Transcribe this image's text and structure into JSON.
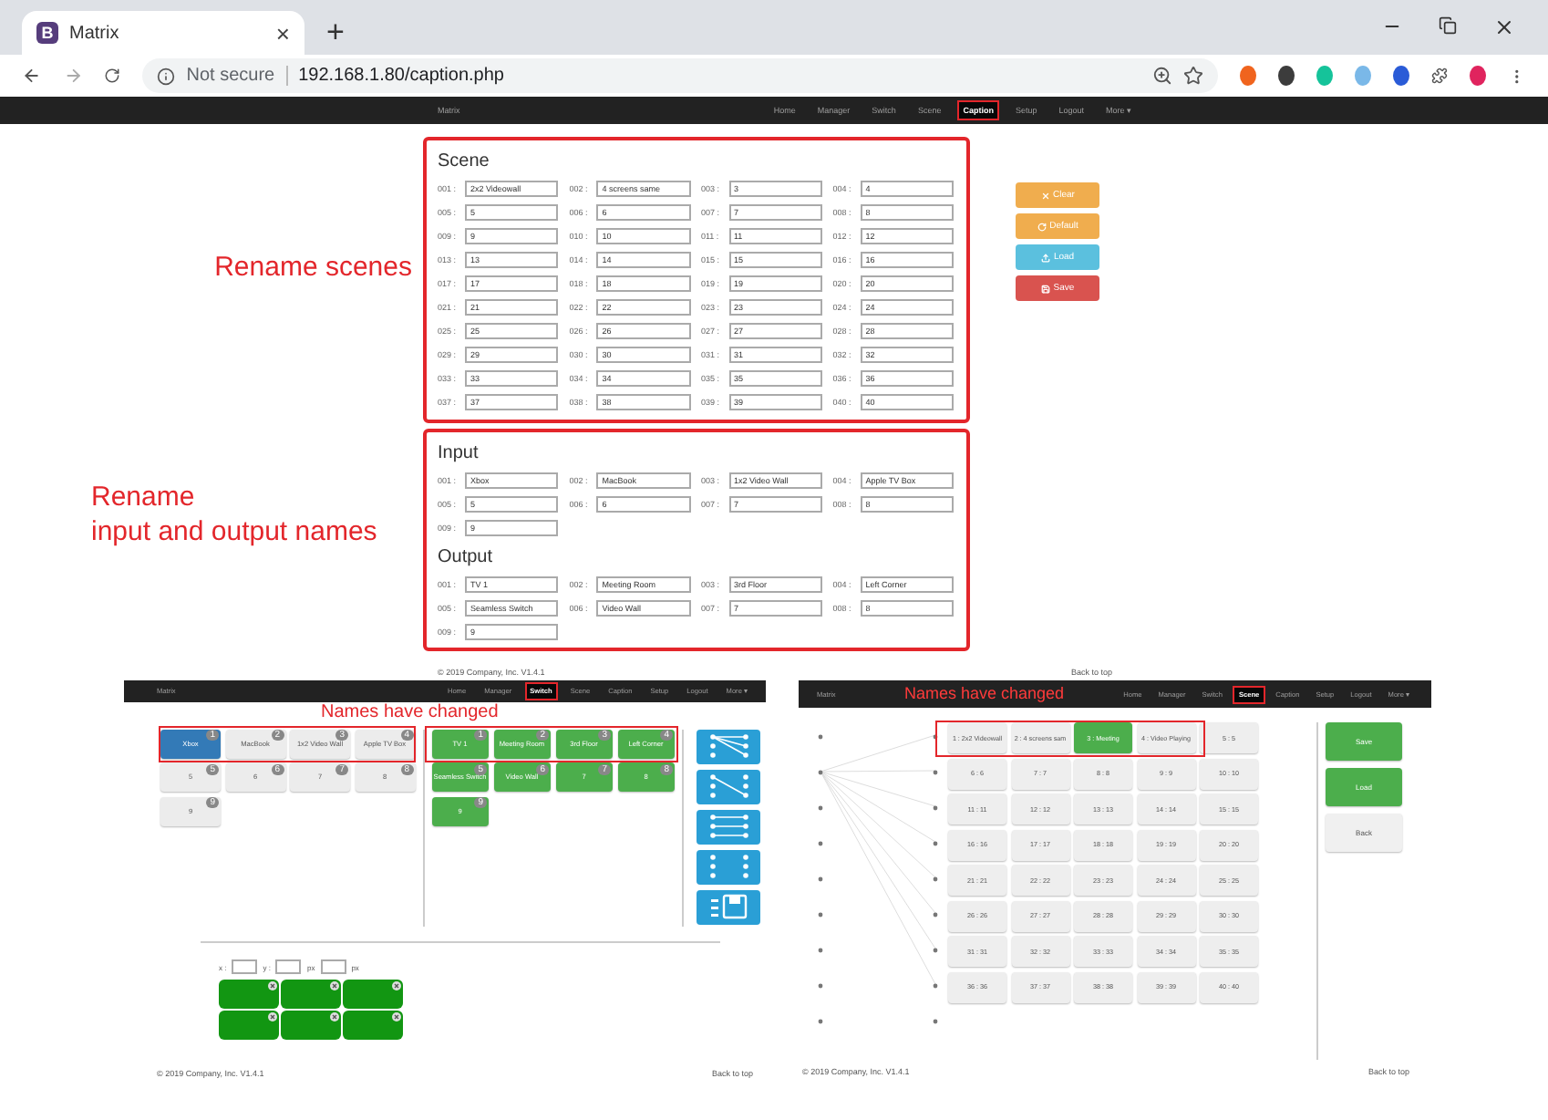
{
  "browser": {
    "favicon": "B",
    "tab_title": "Matrix",
    "tab_close": "×",
    "new_tab": "+",
    "security": "Not secure",
    "url": "192.168.1.80/caption.php"
  },
  "navbar": {
    "brand": "Matrix",
    "items": [
      {
        "label": "Home",
        "selected": false
      },
      {
        "label": "Manager",
        "selected": false
      },
      {
        "label": "Switch",
        "selected": false
      },
      {
        "label": "Scene",
        "selected": false
      },
      {
        "label": "Caption",
        "selected": true
      },
      {
        "label": "Setup",
        "selected": false
      },
      {
        "label": "Logout",
        "selected": false
      },
      {
        "label": "More ▾",
        "selected": false
      }
    ]
  },
  "annotations": {
    "rename_scenes": "Rename scenes",
    "rename_io": [
      "Rename",
      "input and output names"
    ]
  },
  "scene": {
    "title": "Scene",
    "fields": [
      {
        "label": "001 :",
        "value": "2x2 Videowall"
      },
      {
        "label": "002 :",
        "value": "4 screens same"
      },
      {
        "label": "003 :",
        "value": "3"
      },
      {
        "label": "004 :",
        "value": "4"
      },
      {
        "label": "005 :",
        "value": "5"
      },
      {
        "label": "006 :",
        "value": "6"
      },
      {
        "label": "007 :",
        "value": "7"
      },
      {
        "label": "008 :",
        "value": "8"
      },
      {
        "label": "009 :",
        "value": "9"
      },
      {
        "label": "010 :",
        "value": "10"
      },
      {
        "label": "011 :",
        "value": "11"
      },
      {
        "label": "012 :",
        "value": "12"
      },
      {
        "label": "013 :",
        "value": "13"
      },
      {
        "label": "014 :",
        "value": "14"
      },
      {
        "label": "015 :",
        "value": "15"
      },
      {
        "label": "016 :",
        "value": "16"
      },
      {
        "label": "017 :",
        "value": "17"
      },
      {
        "label": "018 :",
        "value": "18"
      },
      {
        "label": "019 :",
        "value": "19"
      },
      {
        "label": "020 :",
        "value": "20"
      },
      {
        "label": "021 :",
        "value": "21"
      },
      {
        "label": "022 :",
        "value": "22"
      },
      {
        "label": "023 :",
        "value": "23"
      },
      {
        "label": "024 :",
        "value": "24"
      },
      {
        "label": "025 :",
        "value": "25"
      },
      {
        "label": "026 :",
        "value": "26"
      },
      {
        "label": "027 :",
        "value": "27"
      },
      {
        "label": "028 :",
        "value": "28"
      },
      {
        "label": "029 :",
        "value": "29"
      },
      {
        "label": "030 :",
        "value": "30"
      },
      {
        "label": "031 :",
        "value": "31"
      },
      {
        "label": "032 :",
        "value": "32"
      },
      {
        "label": "033 :",
        "value": "33"
      },
      {
        "label": "034 :",
        "value": "34"
      },
      {
        "label": "035 :",
        "value": "35"
      },
      {
        "label": "036 :",
        "value": "36"
      },
      {
        "label": "037 :",
        "value": "37"
      },
      {
        "label": "038 :",
        "value": "38"
      },
      {
        "label": "039 :",
        "value": "39"
      },
      {
        "label": "040 :",
        "value": "40"
      }
    ]
  },
  "actions": [
    {
      "kind": "clear",
      "label": "Clear",
      "color": "#f0ad4e"
    },
    {
      "kind": "default",
      "label": "Default",
      "color": "#f0ad4e"
    },
    {
      "kind": "load",
      "label": "Load",
      "color": "#5bc0de"
    },
    {
      "kind": "save",
      "label": "Save",
      "color": "#d9534f"
    }
  ],
  "input": {
    "title": "Input",
    "fields": [
      {
        "label": "001 :",
        "value": "Xbox"
      },
      {
        "label": "002 :",
        "value": "MacBook"
      },
      {
        "label": "003 :",
        "value": "1x2 Video Wall"
      },
      {
        "label": "004 :",
        "value": "Apple TV Box"
      },
      {
        "label": "005 :",
        "value": "5"
      },
      {
        "label": "006 :",
        "value": "6"
      },
      {
        "label": "007 :",
        "value": "7"
      },
      {
        "label": "008 :",
        "value": "8"
      },
      {
        "label": "009 :",
        "value": "9"
      }
    ]
  },
  "output": {
    "title": "Output",
    "fields": [
      {
        "label": "001 :",
        "value": "TV 1"
      },
      {
        "label": "002 :",
        "value": "Meeting Room"
      },
      {
        "label": "003 :",
        "value": "3rd Floor"
      },
      {
        "label": "004 :",
        "value": "Left Corner"
      },
      {
        "label": "005 :",
        "value": "Seamless Switch"
      },
      {
        "label": "006 :",
        "value": "Video Wall"
      },
      {
        "label": "007 :",
        "value": "7"
      },
      {
        "label": "008 :",
        "value": "8"
      },
      {
        "label": "009 :",
        "value": "9"
      }
    ]
  },
  "footer": {
    "copyright": "© 2019 Company, Inc. V1.4.1",
    "back_to_top": "Back to top"
  },
  "switch_screen": {
    "navbar": {
      "brand": "Matrix",
      "items": [
        {
          "label": "Home",
          "selected": false
        },
        {
          "label": "Manager",
          "selected": false
        },
        {
          "label": "Switch",
          "selected": true
        },
        {
          "label": "Scene",
          "selected": false
        },
        {
          "label": "Caption",
          "selected": false
        },
        {
          "label": "Setup",
          "selected": false
        },
        {
          "label": "Logout",
          "selected": false
        },
        {
          "label": "More ▾",
          "selected": false
        }
      ]
    },
    "note": "Names have changed",
    "inputs": [
      {
        "label": "Xbox",
        "badge": "1",
        "selected": true
      },
      {
        "label": "MacBook",
        "badge": "2",
        "selected": false
      },
      {
        "label": "1x2 Video Wall",
        "badge": "3",
        "selected": false
      },
      {
        "label": "Apple TV Box",
        "badge": "4",
        "selected": false
      },
      {
        "label": "5",
        "badge": "5",
        "selected": false
      },
      {
        "label": "6",
        "badge": "6",
        "selected": false
      },
      {
        "label": "7",
        "badge": "7",
        "selected": false
      },
      {
        "label": "8",
        "badge": "8",
        "selected": false
      },
      {
        "label": "9",
        "badge": "9",
        "selected": false
      }
    ],
    "outputs": [
      {
        "label": "TV 1",
        "badge": "1"
      },
      {
        "label": "Meeting Room",
        "badge": "2"
      },
      {
        "label": "3rd Floor",
        "badge": "3"
      },
      {
        "label": "Left Corner",
        "badge": "4"
      },
      {
        "label": "Seamless Switch",
        "badge": "5"
      },
      {
        "label": "Video Wall",
        "badge": "6"
      },
      {
        "label": "7",
        "badge": "7"
      },
      {
        "label": "8",
        "badge": "8"
      },
      {
        "label": "9",
        "badge": "9"
      }
    ],
    "position": {
      "x_label": "x :",
      "y_label": "y :",
      "w_unit": "px",
      "h_unit": "px"
    },
    "footer": {
      "copyright": "© 2019 Company, Inc. V1.4.1",
      "back_to_top": "Back to top"
    }
  },
  "scene_screen": {
    "navbar": {
      "brand": "Matrix",
      "items": [
        {
          "label": "Home",
          "selected": false
        },
        {
          "label": "Manager",
          "selected": false
        },
        {
          "label": "Switch",
          "selected": false
        },
        {
          "label": "Scene",
          "selected": true
        },
        {
          "label": "Caption",
          "selected": false
        },
        {
          "label": "Setup",
          "selected": false
        },
        {
          "label": "Logout",
          "selected": false
        },
        {
          "label": "More ▾",
          "selected": false
        }
      ]
    },
    "note": "Names have changed",
    "scenes": [
      {
        "label": "1 : 2x2 Videowall",
        "selected": false
      },
      {
        "label": "2 : 4 screens sam",
        "selected": false
      },
      {
        "label": "3 : Meeting",
        "selected": true
      },
      {
        "label": "4 : Video Playing",
        "selected": false
      },
      {
        "label": "5 : 5",
        "selected": false
      },
      {
        "label": "6 : 6",
        "selected": false
      },
      {
        "label": "7 : 7",
        "selected": false
      },
      {
        "label": "8 : 8",
        "selected": false
      },
      {
        "label": "9 : 9",
        "selected": false
      },
      {
        "label": "10 : 10",
        "selected": false
      },
      {
        "label": "11 : 11",
        "selected": false
      },
      {
        "label": "12 : 12",
        "selected": false
      },
      {
        "label": "13 : 13",
        "selected": false
      },
      {
        "label": "14 : 14",
        "selected": false
      },
      {
        "label": "15 : 15",
        "selected": false
      },
      {
        "label": "16 : 16",
        "selected": false
      },
      {
        "label": "17 : 17",
        "selected": false
      },
      {
        "label": "18 : 18",
        "selected": false
      },
      {
        "label": "19 : 19",
        "selected": false
      },
      {
        "label": "20 : 20",
        "selected": false
      },
      {
        "label": "21 : 21",
        "selected": false
      },
      {
        "label": "22 : 22",
        "selected": false
      },
      {
        "label": "23 : 23",
        "selected": false
      },
      {
        "label": "24 : 24",
        "selected": false
      },
      {
        "label": "25 : 25",
        "selected": false
      },
      {
        "label": "26 : 26",
        "selected": false
      },
      {
        "label": "27 : 27",
        "selected": false
      },
      {
        "label": "28 : 28",
        "selected": false
      },
      {
        "label": "29 : 29",
        "selected": false
      },
      {
        "label": "30 : 30",
        "selected": false
      },
      {
        "label": "31 : 31",
        "selected": false
      },
      {
        "label": "32 : 32",
        "selected": false
      },
      {
        "label": "33 : 33",
        "selected": false
      },
      {
        "label": "34 : 34",
        "selected": false
      },
      {
        "label": "35 : 35",
        "selected": false
      },
      {
        "label": "36 : 36",
        "selected": false
      },
      {
        "label": "37 : 37",
        "selected": false
      },
      {
        "label": "38 : 38",
        "selected": false
      },
      {
        "label": "39 : 39",
        "selected": false
      },
      {
        "label": "40 : 40",
        "selected": false
      }
    ],
    "buttons": [
      {
        "kind": "primary",
        "label": "Save"
      },
      {
        "kind": "primary",
        "label": "Load"
      },
      {
        "kind": "plain",
        "label": "Back"
      }
    ],
    "footer": {
      "copyright": "© 2019 Company, Inc. V1.4.1",
      "back_to_top": "Back to top"
    }
  }
}
